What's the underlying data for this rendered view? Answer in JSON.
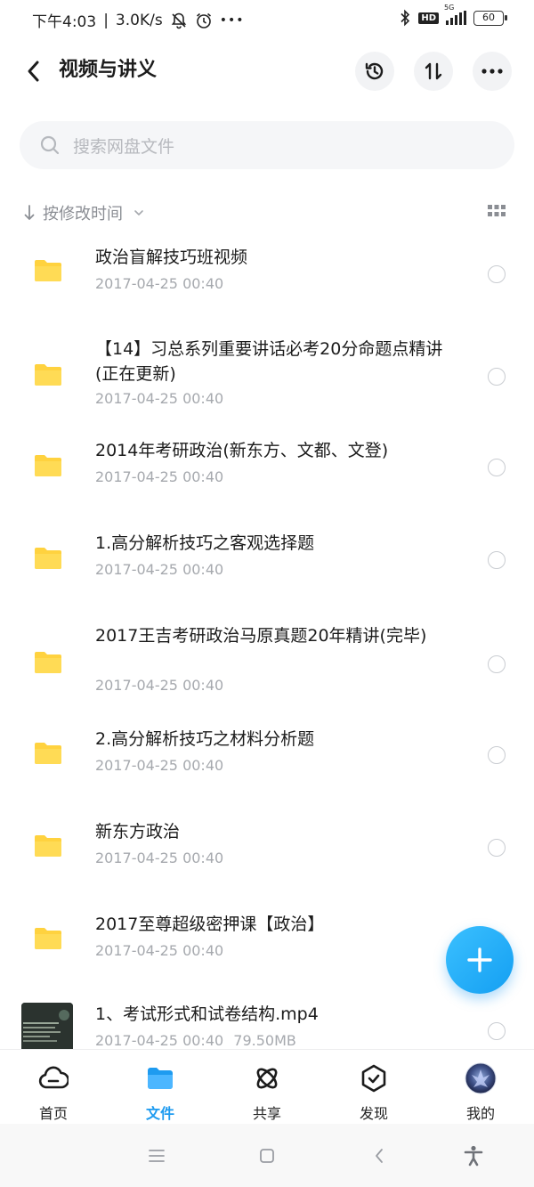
{
  "status_bar": {
    "time": "下午4:03",
    "speed": "3.0K/s",
    "more": "•••",
    "network": "5G",
    "hd": "HD",
    "battery": "60"
  },
  "header": {
    "title": "视频与讲义"
  },
  "search": {
    "placeholder": "搜索网盘文件"
  },
  "sort": {
    "label": "按修改时间"
  },
  "files": [
    {
      "name": "政治盲解技巧班视频",
      "date": "2017-04-25  00:40",
      "size": "",
      "type": "folder"
    },
    {
      "name": "【14】习总系列重要讲话必考20分命题点精讲(正在更新)",
      "date": "2017-04-25  00:40",
      "size": "",
      "type": "folder"
    },
    {
      "name": "2014年考研政治(新东方、文都、文登)",
      "date": "2017-04-25  00:40",
      "size": "",
      "type": "folder"
    },
    {
      "name": "1.高分解析技巧之客观选择题",
      "date": "2017-04-25  00:40",
      "size": "",
      "type": "folder"
    },
    {
      "name": "2017王吉考研政治马原真题20年精讲(完毕)",
      "date": "2017-04-25  00:40",
      "size": "",
      "type": "folder"
    },
    {
      "name": "2.高分解析技巧之材料分析题",
      "date": "2017-04-25  00:40",
      "size": "",
      "type": "folder"
    },
    {
      "name": "新东方政治",
      "date": "2017-04-25  00:40",
      "size": "",
      "type": "folder"
    },
    {
      "name": "2017至尊超级密押课【政治】",
      "date": "2017-04-25  00:40",
      "size": "",
      "type": "folder"
    },
    {
      "name": "1、考试形式和试卷结构.mp4",
      "date": "2017-04-25  00:40",
      "size": "79.50MB",
      "type": "video"
    }
  ],
  "tabs": [
    {
      "label": "首页",
      "icon": "cloud-icon"
    },
    {
      "label": "文件",
      "icon": "folder-icon"
    },
    {
      "label": "共享",
      "icon": "atom-icon"
    },
    {
      "label": "发现",
      "icon": "discover-icon"
    },
    {
      "label": "我的",
      "icon": "avatar"
    }
  ],
  "colors": {
    "accent": "#1e9bf0",
    "folder": "#ffd23f",
    "fab": "#1fa9f5"
  }
}
